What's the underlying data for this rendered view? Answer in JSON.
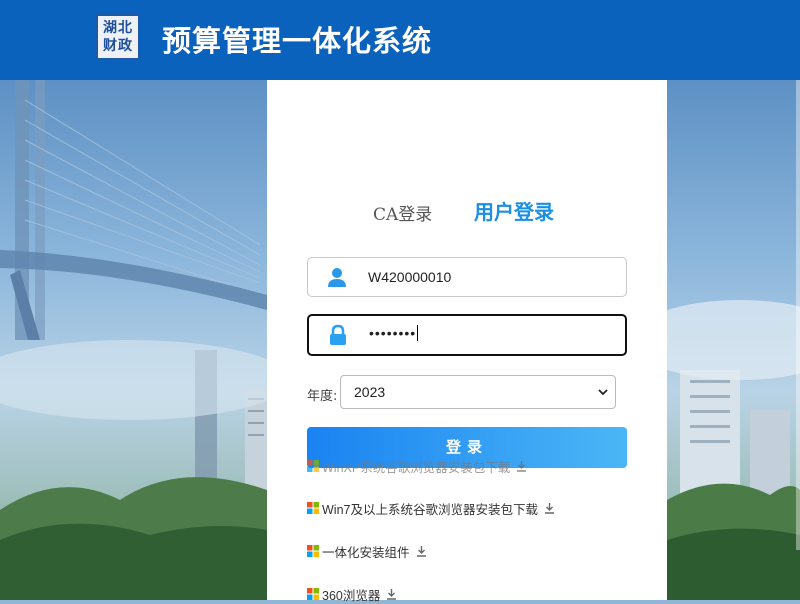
{
  "header": {
    "logo_text": [
      "湖北",
      "财政"
    ],
    "title": "预算管理一体化系统",
    "brand_color": "#0a62bd"
  },
  "login": {
    "tabs": [
      {
        "label": "CA登录",
        "active": false
      },
      {
        "label": "用户登录",
        "active": true
      }
    ],
    "username": {
      "value": "W420000010",
      "icon": "user-icon"
    },
    "password": {
      "value": "••••••••",
      "icon": "lock-icon"
    },
    "year": {
      "label": "年度:",
      "selected": "2023"
    },
    "submit_label": "登录",
    "accent_color": "#1a8fe3"
  },
  "downloads": [
    {
      "label": "WinXP系统谷歌浏览器安装包下载",
      "icon": "windows-icon"
    },
    {
      "label": "Win7及以上系统谷歌浏览器安装包下载",
      "icon": "windows-icon"
    },
    {
      "label": "一体化安装组件",
      "icon": "windows-icon"
    },
    {
      "label": "360浏览器",
      "icon": "windows-icon"
    }
  ]
}
